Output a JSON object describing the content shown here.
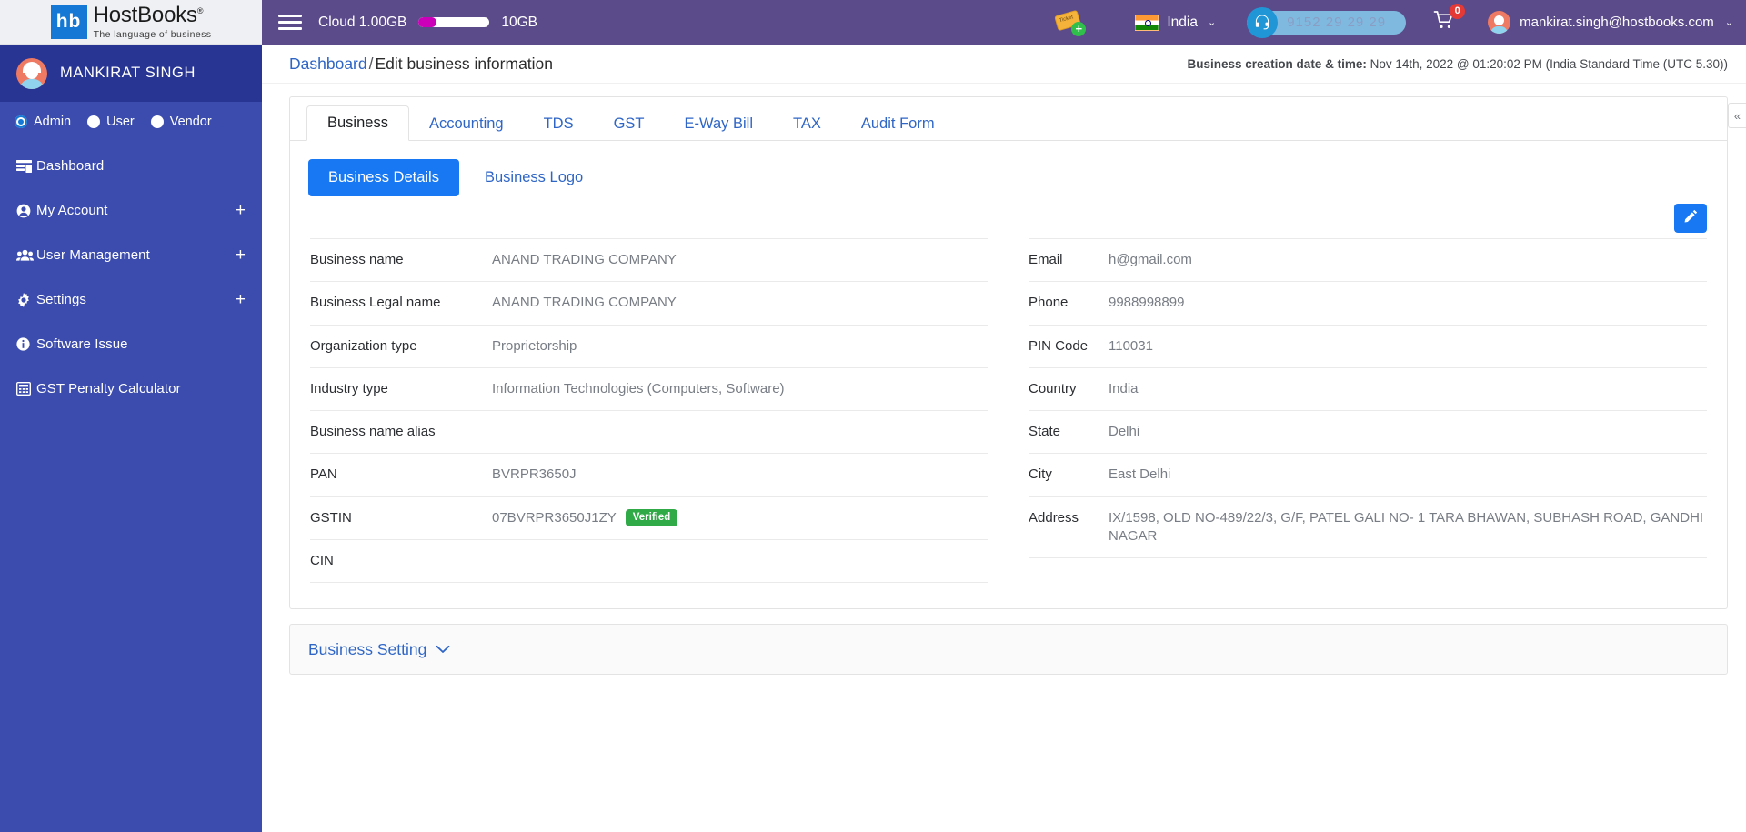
{
  "brand": {
    "mark": "hb",
    "name": "HostBooks",
    "registered": "®",
    "tagline": "The language of business"
  },
  "sidebar": {
    "profile_name": "MANKIRAT SINGH",
    "roles": [
      {
        "label": "Admin",
        "selected": true
      },
      {
        "label": "User",
        "selected": false
      },
      {
        "label": "Vendor",
        "selected": false
      }
    ],
    "items": [
      {
        "label": "Dashboard",
        "icon": "dashboard-icon",
        "expandable": false
      },
      {
        "label": "My Account",
        "icon": "user-circle-icon",
        "expandable": true
      },
      {
        "label": "User Management",
        "icon": "users-icon",
        "expandable": true
      },
      {
        "label": "Settings",
        "icon": "gear-icon",
        "expandable": true
      },
      {
        "label": "Software Issue",
        "icon": "info-icon",
        "expandable": false
      },
      {
        "label": "GST Penalty Calculator",
        "icon": "calculator-icon",
        "expandable": false
      }
    ],
    "expand_symbol": "+"
  },
  "topbar": {
    "menu_icon": "hamburger-icon",
    "cloud_label": "Cloud 1.00GB",
    "cloud_used_percent": 25,
    "cloud_total": "10GB",
    "ticket_icon": "add-ticket-icon",
    "country": "India",
    "country_caret": "⌄",
    "support_phone": "9152 29 29 29",
    "support_icon": "headset-icon",
    "cart_icon": "cart-icon",
    "cart_count": "0",
    "user_email": "mankirat.singh@hostbooks.com",
    "user_caret": "⌄"
  },
  "breadcrumb": {
    "root": "Dashboard",
    "separator": "/",
    "current": "Edit business information"
  },
  "meta": {
    "creation_label": "Business creation date & time:",
    "creation_value": "Nov 14th, 2022 @ 01:20:02 PM (India Standard Time (UTC 5.30))"
  },
  "tabs": [
    {
      "label": "Business",
      "active": true
    },
    {
      "label": "Accounting",
      "active": false
    },
    {
      "label": "TDS",
      "active": false
    },
    {
      "label": "GST",
      "active": false
    },
    {
      "label": "E-Way Bill",
      "active": false
    },
    {
      "label": "TAX",
      "active": false
    },
    {
      "label": "Audit Form",
      "active": false
    }
  ],
  "subtabs": [
    {
      "label": "Business Details",
      "active": true
    },
    {
      "label": "Business Logo",
      "active": false
    }
  ],
  "edit_button": {
    "icon": "pencil-icon",
    "color": "#1877f2"
  },
  "details_left": [
    {
      "label": "Business name",
      "value": "ANAND TRADING COMPANY"
    },
    {
      "label": "Business Legal name",
      "value": "ANAND TRADING COMPANY"
    },
    {
      "label": "Organization type",
      "value": "Proprietorship"
    },
    {
      "label": "Industry type",
      "value": "Information Technologies (Computers, Software)"
    },
    {
      "label": "Business name alias",
      "value": ""
    },
    {
      "label": "PAN",
      "value": "BVRPR3650J"
    },
    {
      "label": "GSTIN",
      "value": "07BVRPR3650J1ZY",
      "badge": "Verified"
    },
    {
      "label": "CIN",
      "value": ""
    }
  ],
  "details_right": [
    {
      "label": "Email",
      "value": "h@gmail.com"
    },
    {
      "label": "Phone",
      "value": "9988998899"
    },
    {
      "label": "PIN Code",
      "value": "110031"
    },
    {
      "label": "Country",
      "value": "India"
    },
    {
      "label": "State",
      "value": "Delhi"
    },
    {
      "label": "City",
      "value": "East Delhi"
    },
    {
      "label": "Address",
      "value": "IX/1598, OLD NO-489/22/3, G/F, PATEL GALI NO- 1 TARA BHAWAN, SUBHASH ROAD, GANDHI NAGAR"
    }
  ],
  "business_setting": {
    "label": "Business Setting",
    "chevron": "⌄"
  },
  "collapse_handle": {
    "icon": "chevron-double-left-icon",
    "glyph": "«"
  },
  "colors": {
    "sidebar": "#3b4cae",
    "topbar": "#5c4b8a",
    "accent_blue": "#1877f2",
    "link_blue": "#2f66c6",
    "verified_green": "#2faa47",
    "cloud_fill": "#cc00b8"
  }
}
